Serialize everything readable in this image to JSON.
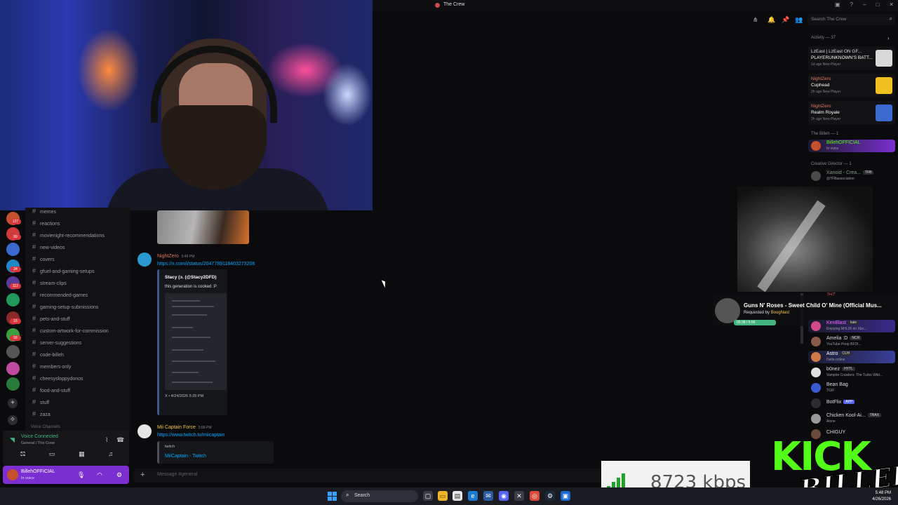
{
  "window": {
    "title": "The Crew",
    "search_placeholder": "Search The Crew"
  },
  "server_badges": [
    "127",
    "89",
    "34",
    "112",
    "16",
    "58"
  ],
  "channels": [
    "memes",
    "reactions",
    "movienight-recommendations",
    "new-videos",
    "covers",
    "gfuel-and-gaming-setups",
    "stream-clips",
    "recommended-games",
    "gaming-setup-submissions",
    "pets-and-stuff",
    "custom-artwork-for-commission",
    "server-suggestions",
    "code-billeh",
    "members-only",
    "cheesysloppydonos",
    "food-and-stuff",
    "stuff",
    "zaza"
  ],
  "channel_category": "Voice Channels",
  "voice": {
    "status": "Voice Connected",
    "location": "General / The Crew"
  },
  "user": {
    "name": "BillehOFFICIAL",
    "status": "In voice"
  },
  "messages": [
    {
      "author": "NightZero",
      "time": "5:49 PM",
      "link": "https://x.com/i/status/2047789118403273208",
      "embed_author": "Stacy (ↄ. (@Stacy2DFD)",
      "embed_desc": "this generation is cooked :P",
      "embed_footer": "X • 4/24/2026 5:25 PM"
    },
    {
      "author": "Mii Captain Force",
      "time": "5:58 PM",
      "link": "https://www.twitch.tv/miicaptain",
      "embed_provider": "twitch",
      "embed_title": "MiiCaptain - Twitch"
    }
  ],
  "message_placeholder": "Message #general",
  "activity": {
    "header": "Activity — 37",
    "cards": [
      {
        "user": "LzEast | LzEast ON GF...",
        "game": "PLAYERUNKNOWN'S BATT...",
        "meta": "1d ago  New Player",
        "thumb_color": "#d9d9d9"
      },
      {
        "user": "NightZero",
        "game": "Cuphead",
        "meta": "2h ago  New Player",
        "thumb_color": "#f0c020"
      },
      {
        "user": "NightZero",
        "game": "Realm Royale",
        "meta": "2h ago  New Player",
        "thumb_color": "#3a6ad0"
      }
    ]
  },
  "member_sections": [
    {
      "header": "The Billeh — 1",
      "members": [
        {
          "name": "BillehOFFICIAL",
          "sub": "In voice",
          "color": "#53fc18",
          "bg": "#7b2fd0"
        }
      ]
    },
    {
      "header": "Creative Director — 1",
      "members": [
        {
          "name": "Xanoid - Crea...",
          "tag": "TFB",
          "sub": "@TFBassociation",
          "color": "#7f9a7f",
          "bg": ""
        }
      ]
    }
  ],
  "members": [
    {
      "name": "JHZ",
      "sub": "",
      "tag": "",
      "color": "#c84a4a"
    },
    {
      "name": "KenBlast",
      "tag": "kale",
      "sub": "Enjoying NHL26 on Xbo...",
      "color": "#f06aff",
      "bg": "#3a2a8a"
    },
    {
      "name": "Amelia :D",
      "tag": "NCR",
      "sub": "YouTube Poop BFDI...",
      "color": "#dbdee1",
      "bg": ""
    },
    {
      "name": "Astro",
      "tag": "CUH",
      "sub": "Delta online",
      "color": "#ffffff",
      "bg": "#3a3f9a"
    },
    {
      "name": "b0nez",
      "tag": "HYTL",
      "sub": "Vampire Crawlers: The Turbo Wild...",
      "color": "#dbdee1",
      "bg": ""
    },
    {
      "name": "Bean Bag",
      "tag": "",
      "sub": "TGIF",
      "color": "#dbdee1",
      "bg": ""
    },
    {
      "name": "BotFlix",
      "tag": "APP",
      "sub": "",
      "color": "#dbdee1",
      "bg": ""
    },
    {
      "name": "Chicken Kool-Ai...",
      "tag": "TRAX",
      "sub": "Alone",
      "color": "#dbdee1",
      "bg": ""
    },
    {
      "name": "CHIGUY",
      "tag": "",
      "sub": "",
      "color": "#dbdee1",
      "bg": ""
    }
  ],
  "music": {
    "title": "Guns N' Roses - Sweet Child O' Mine (Official Mus...",
    "requested_prefix": "Requested by",
    "requested_by": "BoogNast",
    "time": "05:38 / 5:56"
  },
  "stream": {
    "kbps": "8723 kbps",
    "brand": "KICK",
    "signature": "BILLEH"
  },
  "taskbar": {
    "search_label": "Search",
    "time": "5:48 PM",
    "date": "4/26/2026"
  }
}
